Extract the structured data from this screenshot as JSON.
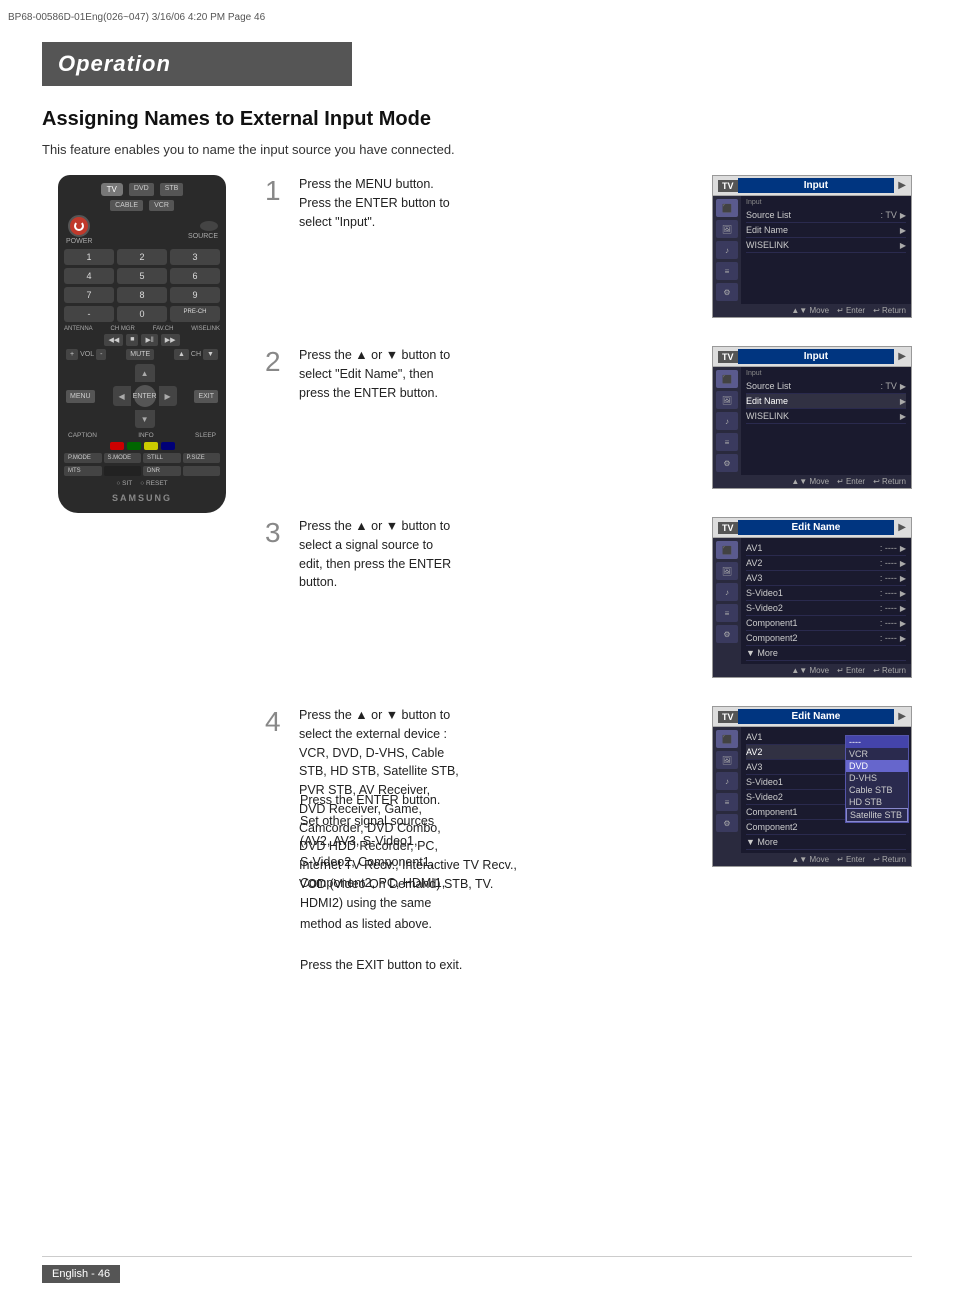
{
  "header": {
    "file_info": "BP68-00586D-01Eng(026~047)   3/16/06   4:20 PM   Page 46"
  },
  "operation": {
    "title": "Operation",
    "section_title": "Assigning Names to External Input Mode",
    "subtitle": "This feature enables you to name the input source you have connected."
  },
  "steps": [
    {
      "number": "1",
      "text": "Press the MENU button.\nPress the ENTER button to\nselect \"Input\".",
      "screen_title": "Input",
      "menu_items": [
        {
          "name": "Source List",
          "value": ": TV",
          "arrow": true
        },
        {
          "name": "Edit Name",
          "value": "",
          "arrow": true
        },
        {
          "name": "WISELINK",
          "value": "",
          "arrow": true
        }
      ],
      "sidebar_items": [
        "Input",
        "Picture",
        "Sound",
        "Channel",
        "Setup"
      ]
    },
    {
      "number": "2",
      "text": "Press the ▲ or ▼ button to\nselect \"Edit Name\", then\npress the ENTER button.",
      "screen_title": "Input",
      "menu_items": [
        {
          "name": "Source List",
          "value": ": TV",
          "arrow": true
        },
        {
          "name": "Edit Name",
          "value": "",
          "arrow": true,
          "highlighted": true
        },
        {
          "name": "WISELINK",
          "value": "",
          "arrow": true
        }
      ],
      "sidebar_items": [
        "Input",
        "Picture",
        "Sound",
        "Channel",
        "Setup"
      ]
    },
    {
      "number": "3",
      "text": "Press the ▲ or ▼ button to\nselect a signal source to\nedit, then press the ENTER\nbutton.",
      "screen_title": "Edit Name",
      "menu_items": [
        {
          "name": "AV1",
          "value": ": ----",
          "arrow": true
        },
        {
          "name": "AV2",
          "value": ": ----",
          "arrow": true
        },
        {
          "name": "AV3",
          "value": ": ----",
          "arrow": true
        },
        {
          "name": "S-Video1",
          "value": ": ----",
          "arrow": true
        },
        {
          "name": "S-Video2",
          "value": ": ----",
          "arrow": true
        },
        {
          "name": "Component1",
          "value": ": ----",
          "arrow": true
        },
        {
          "name": "Component2",
          "value": ": ----",
          "arrow": true
        },
        {
          "name": "▼ More",
          "value": "",
          "arrow": false
        }
      ],
      "sidebar_items": [
        "Input",
        "Picture",
        "Sound",
        "Channel",
        "Setup"
      ]
    },
    {
      "number": "4",
      "text": "Press the ▲ or ▼ button to\nselect the external device :\nVCR, DVD, D-VHS, Cable\nSTB, HD STB, Satellite STB,\nPVR STB, AV Receiver,\nDVD Receiver, Game,\nCamcorder, DVD Combo,\nDVD HDD Recorder, PC,\nInternet TV Recv., Interactive TV Recv.,\nVOD (Video On Demand) STB, TV.",
      "screen_title": "Edit Name",
      "menu_items": [
        {
          "name": "AV1",
          "value": "",
          "arrow": false
        },
        {
          "name": "AV2",
          "value": "",
          "arrow": false
        },
        {
          "name": "AV3",
          "value": "",
          "arrow": false
        },
        {
          "name": "S-Video1",
          "value": "",
          "arrow": false
        },
        {
          "name": "S-Video2",
          "value": "",
          "arrow": false
        },
        {
          "name": "Component1",
          "value": "",
          "arrow": false
        },
        {
          "name": "Component2",
          "value": "",
          "arrow": false
        },
        {
          "name": "▼ More",
          "value": "",
          "arrow": false
        }
      ],
      "dropdown_items": [
        {
          "name": "----",
          "highlighted": true
        },
        {
          "name": "VCR",
          "selected": true
        },
        {
          "name": "DVD",
          "selected": false
        },
        {
          "name": "D-VHS",
          "selected": false
        },
        {
          "name": "Cable STB",
          "selected": false
        },
        {
          "name": "HD STB",
          "selected": false
        },
        {
          "name": "Satellite STB",
          "selected": false,
          "highlight_border": true
        }
      ],
      "sidebar_items": [
        "Input",
        "Picture",
        "Sound",
        "Channel",
        "Setup"
      ]
    }
  ],
  "step4_extra": {
    "para1": "Press the ENTER button.\nSet other signal sources\n(AV2, AV3, S-Video1,\nS-Video2, Component1,\nComponent2, PC, HDMI1,\nHDMI2) using the same\nmethod as listed above.",
    "para2": "Press the EXIT button to exit."
  },
  "footer": {
    "badge": "English - 46",
    "page_label": "46"
  },
  "tv_bottom_nav": {
    "move": "▲▼ Move",
    "enter": "↵ Enter",
    "return": "↩ Return"
  },
  "remote": {
    "chips": [
      "DVD",
      "STB",
      "CABLE",
      "VCR"
    ],
    "tv_label": "TV",
    "power_label": "POWER",
    "source_label": "SOURCE",
    "numbers": [
      "1",
      "2",
      "3",
      "4",
      "5",
      "6",
      "7",
      "8",
      "9",
      "-",
      "0",
      "PRE-CH"
    ],
    "special": [
      "ANTENNA",
      "CH MGR",
      "FAV.CH",
      "WISELINK"
    ],
    "transport": [
      "REW",
      "STOP",
      "PLAY/PAUSE",
      "FF"
    ],
    "vol_ch": [
      "VOL",
      "CH",
      "MUTE"
    ],
    "nav_labels": [
      "MENU",
      "EXIT",
      "ENTER"
    ],
    "caption_info_sleep": [
      "CAPTION",
      "INFO",
      "SLEEP"
    ],
    "mode_btns": [
      "P.MODE",
      "S.MODE",
      "STILL",
      "P.SIZE",
      "MTS",
      "",
      "DNR"
    ],
    "samsung": "SAMSUNG",
    "sit_reset": [
      "SIT",
      "RESET"
    ]
  }
}
